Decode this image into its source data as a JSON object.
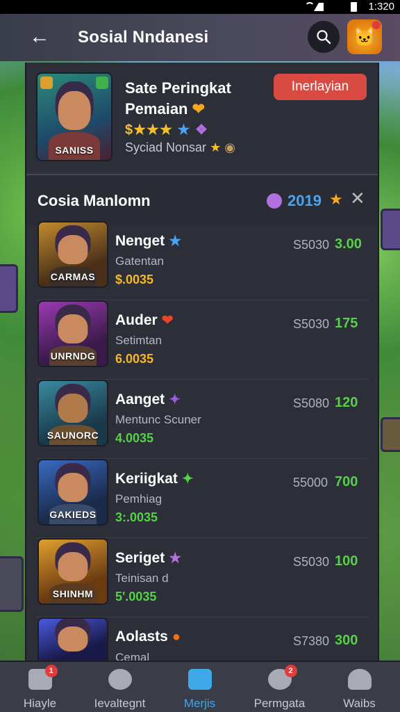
{
  "status_bar": {
    "time": "1:320"
  },
  "header": {
    "title": "Sosial Nndanesi"
  },
  "hero": {
    "title": "Sate Peringkat Pemaian",
    "title_icon": "flame-emoji",
    "image_label": "SANISS",
    "stars": "$★★★",
    "subtitle": "Syciad Nonsar",
    "button_label": "Inerlayian"
  },
  "list": {
    "title": "Cosia Manlomn",
    "year": "2019",
    "items": [
      {
        "name": "Nenget",
        "icon": "★",
        "image_label": "CARMAS",
        "sub": "Gatentan",
        "price": "$.0035",
        "amount": "S5030",
        "value": "3.00",
        "price_color": "gold"
      },
      {
        "name": "Auder",
        "icon": "❤",
        "image_label": "UNRNDG",
        "sub": "Setimtan",
        "price": "6.0035",
        "amount": "S5030",
        "value": "175",
        "price_color": "gold"
      },
      {
        "name": "Aanget",
        "icon": "✦",
        "image_label": "SAUNORC",
        "sub": "Mentunc Scuner",
        "price": "4.0035",
        "amount": "S5080",
        "value": "120",
        "price_color": "green"
      },
      {
        "name": "Keriigkat",
        "icon": "✦",
        "image_label": "GAKIEDS",
        "sub": "Pemhiag",
        "price": "3:.0035",
        "amount": "55000",
        "value": "700",
        "price_color": "green"
      },
      {
        "name": "Seriget",
        "icon": "★",
        "image_label": "SHINHM",
        "sub": "Teinisan d",
        "price": "5'.0035",
        "amount": "S5030",
        "value": "100",
        "price_color": "green"
      },
      {
        "name": "Aolasts",
        "icon": "●",
        "image_label": "",
        "sub": "Cemal",
        "price": "",
        "amount": "S7380",
        "value": "300",
        "price_color": "green"
      }
    ]
  },
  "nav": {
    "items": [
      {
        "label": "Hiayle",
        "badge": "1"
      },
      {
        "label": "Ievaltegnt",
        "badge": ""
      },
      {
        "label": "Merjis",
        "badge": ""
      },
      {
        "label": "Permgata",
        "badge": "2"
      },
      {
        "label": "Waibs",
        "badge": ""
      }
    ]
  },
  "colors": {
    "accent": "#3fa8e8",
    "button": "#d94a42",
    "value_green": "#57d04a",
    "price_gold": "#f5b82a"
  }
}
